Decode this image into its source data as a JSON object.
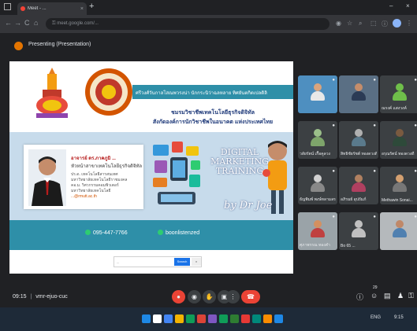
{
  "browser": {
    "tab_title": "Meet - ...",
    "tab_close": "×",
    "new_tab": "+",
    "url": "meet.google.com/...",
    "window_min": "–",
    "window_close": "×",
    "nav_back": "←",
    "nav_forward": "→",
    "nav_reload": "C",
    "nav_home": "⌂"
  },
  "meeting": {
    "header_title": "Presenting (Presentation)"
  },
  "slide": {
    "header_band": "ศรีวงศ์วันกาลโสณพวรงน่า นักกระนิว่าฉลหลาย ทิศยันตกิตเปลดิลิ",
    "org_line1": "ชมรมวิชาชีพเทคโนโลยีธุรกิจดิจิทัล",
    "org_line2": "สังกัดองค์การนักวิชาชีพในอนาคต แห่งประเทศไทย",
    "speaker_name": "อาจารย์ ดร.ภาคภูมิ ...",
    "speaker_role": "หัวหน้าสาขาเทคโนโลยีธุรกิจดิจิทัล",
    "credentials": [
      "ปร.ด. เทคโนโลยีสารสนเทศ",
      "มหาวิทยาลัยเทคโนโลยีราชมงคล",
      "คอ.ม. วิศวกรรมคอมพิวเตอร์",
      "มหาวิทยาลัยเทคโนโลยี"
    ],
    "speaker_email": "...@rmutt.ac.th",
    "title_line1": "DIGITAL",
    "title_line2": "MARKETING",
    "title_line3": "TRAINING",
    "byline": "by Dr Joe",
    "phone": "095-447-7766",
    "line_id": "boonlistenzed",
    "search_placeholder": "...",
    "search_button": "Search",
    "search_button2": "×"
  },
  "participants": [
    {
      "name": "",
      "bg": "#4e8fc0",
      "head": "#d9a47e",
      "body": "#e8e8e8"
    },
    {
      "name": "",
      "bg": "#5a6f84",
      "head": "#c58d6b",
      "body": "#2b3b55"
    },
    {
      "name": "ณรงค์ แสงวงค์",
      "bg": "#3c4043",
      "head": "#6fbf4a",
      "body": "#6fbf4a"
    },
    {
      "name": "วลัยรัตน์ เกื้อคูลวง",
      "bg": "#3c4043",
      "head": "#9bbf8a",
      "body": "#7ea56b"
    },
    {
      "name": "สิทธิชัยรัชต์ ทองดวงดี",
      "bg": "#3c4043",
      "head": "#b0b0b0",
      "body": "#5a7a8c"
    },
    {
      "name": "อรุณรัตน์ ทองดวงดี",
      "bg": "#3c4043",
      "head": "#7a5a40",
      "body": "#2e4a3a"
    },
    {
      "name": "ธัญพิมพ์ พงษ์หลามลร",
      "bg": "#3c4043",
      "head": "#d0d0d0",
      "body": "#888888"
    },
    {
      "name": "อภิรมย์ อุปถัมภ์",
      "bg": "#3c4043",
      "head": "#b08060",
      "body": "#b04060"
    },
    {
      "name": "Methawin Sonai...",
      "bg": "#3c4043",
      "head": "#d4a070",
      "body": "#777777"
    },
    {
      "name": "ศุภาพรรณ ทองคำ",
      "bg": "#9aa3a8",
      "head": "#d49060",
      "body": "#c04040"
    },
    {
      "name": "Bo 65 ...",
      "bg": "#3c4043",
      "head": "#c0c0c0",
      "body": "#c0c0c0"
    },
    {
      "name": "",
      "bg": "#b5b9bc",
      "head": "#c08868",
      "body": "#5080b0"
    }
  ],
  "bottom": {
    "time": "09:15",
    "meeting_code": "vmr-ejuo-cuc",
    "participants_count": "29"
  },
  "icons": {
    "mic": "mic-off-icon",
    "cam": "camera-icon",
    "hand": "raise-hand-icon",
    "present": "present-icon",
    "more": "more-icon",
    "end": "end-call-icon"
  },
  "glyphs": {
    "mic": "●",
    "cam": "◉",
    "hand": "✋",
    "present": "▣",
    "more": "⋮",
    "end": "☎",
    "info": "ⓘ",
    "people": "☺",
    "chat": "▤",
    "activities": "♟",
    "lock": "⚿",
    "star": "☆",
    "ext": "⬚",
    "search": "⌕"
  },
  "taskbar_colors": [
    "#1e88e5",
    "#ffffff",
    "#4285f4",
    "#f4b400",
    "#0f9d58",
    "#db4437",
    "#7e57c2",
    "#0f9d58",
    "#2e7d32",
    "#e53935",
    "#00897b",
    "#fb8c00",
    "#1e88e5"
  ],
  "tray": {
    "lang": "ENG",
    "time": "9:15"
  }
}
